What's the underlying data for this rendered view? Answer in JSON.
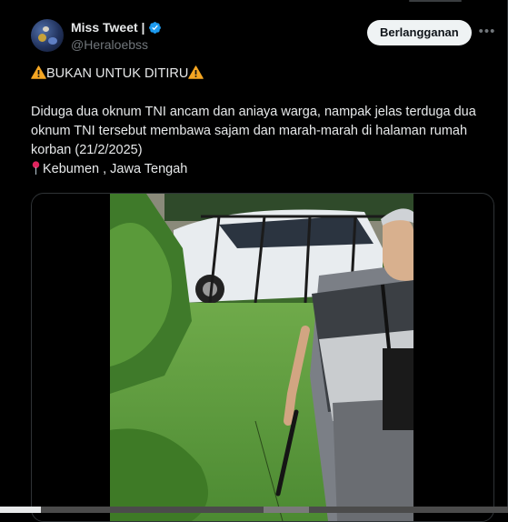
{
  "tweet": {
    "author": {
      "display_name": "Miss Tweet |",
      "handle": "@Heraloebss",
      "verified": true,
      "verified_color": "#1d9bf0"
    },
    "subscribe_label": "Berlangganan",
    "more_icon": "more-horizontal-icon",
    "text": {
      "warning_line": "BUKAN UNTUK DITIRU",
      "body": "Diduga dua oknum TNI ancam dan aniaya warga, nampak jelas terduga dua oknum TNI tersebut  membawa sajam dan marah-marah di halaman rumah korban (21/2/2025)",
      "location": "Kebumen , Jawa Tengah"
    },
    "media": {
      "type": "video",
      "progress": 0.08
    }
  },
  "colors": {
    "background": "#000000",
    "text": "#e7e9ea",
    "secondary_text": "#71767b",
    "border": "#2f3336",
    "button_bg": "#eff3f4",
    "warning": "#f5a623",
    "pin": "#e0245e"
  }
}
